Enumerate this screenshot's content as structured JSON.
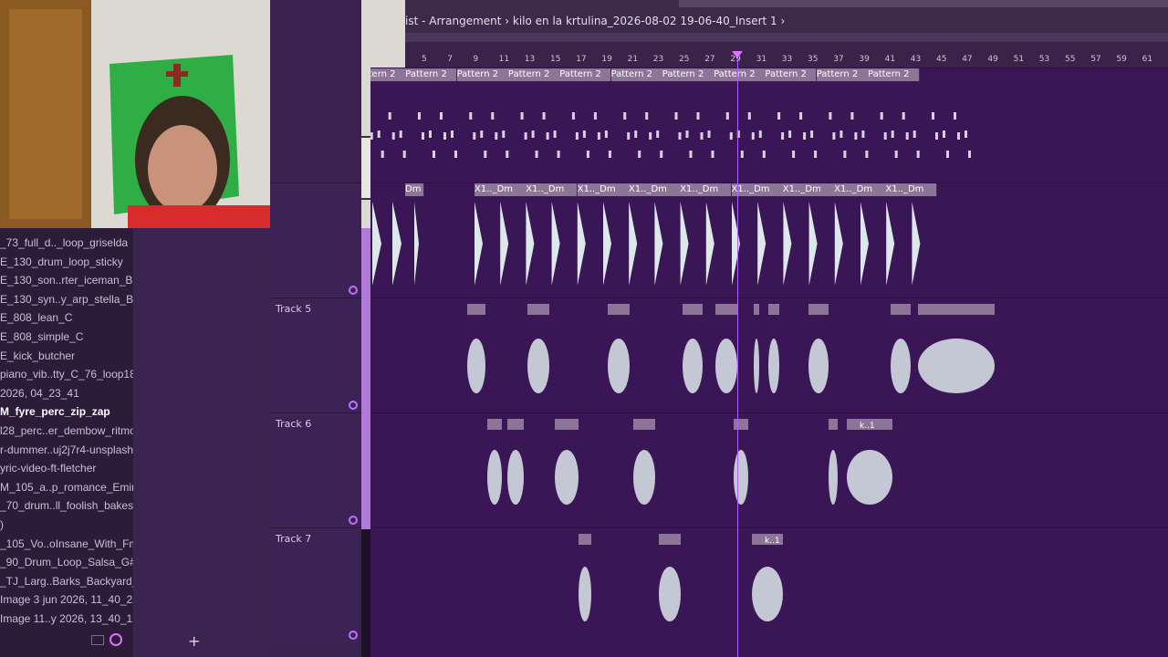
{
  "window": {
    "breadcrumb": "ist - Arrangement › kilo en la krtulina_2026-08-02 19-06-40_Insert 1 ›"
  },
  "ruler": {
    "numbers": [
      "5",
      "7",
      "9",
      "11",
      "13",
      "15",
      "17",
      "19",
      "21",
      "23",
      "25",
      "27",
      "29",
      "31",
      "33",
      "35",
      "37",
      "39",
      "41",
      "43",
      "45",
      "47",
      "49",
      "51",
      "53",
      "55",
      "57",
      "59",
      "61"
    ]
  },
  "browser": {
    "items": [
      "_73_full_d.._loop_griselda",
      "E_130_drum_loop_sticky",
      "E_130_son..rter_iceman_Bm",
      "E_130_syn..y_arp_stella_Bm",
      "E_808_lean_C",
      "E_808_simple_C",
      "E_kick_butcher",
      "piano_vib..tty_C_76_loop18",
      "2026, 04_23_41",
      "M_fyre_perc_zip_zap",
      "l28_perc..er_dembow_ritmo",
      "r-dummer..uj2j7r4-unsplash",
      "yric-video-ft-fletcher",
      "M_105_a..p_romance_Emin",
      "_70_drum..ll_foolish_bakes",
      ")",
      "_105_Vo..oInsane_With_Fm",
      "_90_Drum_Loop_Salsa_G#",
      "_TJ_Larg..Barks_Backyard_2",
      "Image 3 jun 2026, 11_40_23",
      "Image 11..y 2026, 13_40_12"
    ],
    "selected_index": 9
  },
  "tracks": {
    "t5": "Track 5",
    "t6": "Track 6",
    "t7": "Track 7"
  },
  "clips": {
    "pattern_label": "Pattern 2",
    "dm_label": "X1.._Dm",
    "dm_first": "Dm",
    "k1_label": "k..1"
  },
  "midpanel": {
    "add_label": "+"
  },
  "colors": {
    "accent": "#b060ff",
    "clip_header": "#8c7596",
    "playlist_bg": "#3a1656"
  }
}
